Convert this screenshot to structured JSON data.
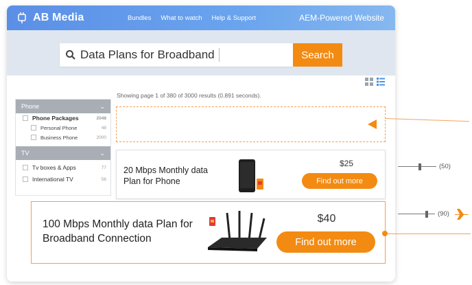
{
  "header": {
    "brand": "AB Media",
    "nav": [
      "Bundles",
      "What to watch",
      "Help & Support"
    ],
    "right_title": "AEM-Powered Website"
  },
  "search": {
    "value": "Data Plans for Broadband",
    "button_label": "Search"
  },
  "results_info": "Showing page 1 of 380 of 3000 results (0.891 seconds).",
  "filters": {
    "phone": {
      "heading": "Phone",
      "items": [
        {
          "label": "Phone Packages",
          "count": "2048"
        },
        {
          "label": "Personal Phone",
          "count": "48"
        },
        {
          "label": "Business Phone",
          "count": "2000"
        }
      ]
    },
    "tv": {
      "heading": "TV",
      "items": [
        {
          "label": "Tv boxes & Apps",
          "count": "77"
        },
        {
          "label": "International TV",
          "count": "56"
        }
      ]
    }
  },
  "cards": {
    "phone_plan": {
      "title": "20 Mbps Monthly data Plan for Phone",
      "price": "$25",
      "button_label": "Find out more"
    },
    "broadband_plan": {
      "title": "100 Mbps Monthly data Plan for Broadband Connection",
      "price": "$40",
      "button_label": "Find out more"
    }
  },
  "sliders": [
    {
      "value_label": "(50)",
      "level": 0.5
    },
    {
      "value_label": "(90)",
      "level": 0.9
    }
  ],
  "colors": {
    "accent": "#f38b12",
    "header_blue": "#5b8fe6"
  },
  "icons": [
    "plug-icon",
    "search-icon",
    "grid-view-icon",
    "list-view-icon",
    "chevron-down-icon",
    "airplane-icon"
  ]
}
